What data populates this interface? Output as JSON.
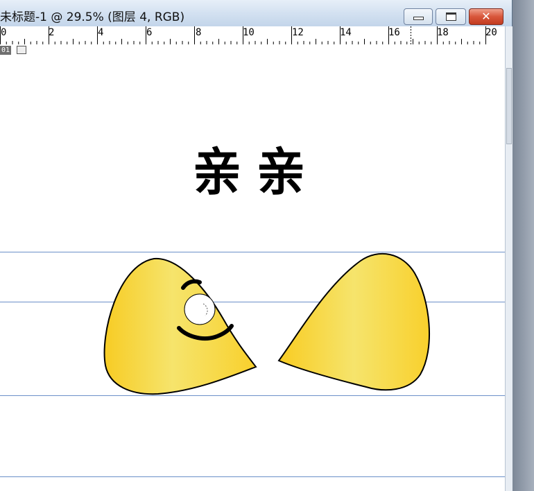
{
  "window": {
    "title": "未标题-1 @ 29.5% (图层 4, RGB)",
    "min_icon": "minimize-icon",
    "max_icon": "maximize-icon",
    "close_icon": "close-icon",
    "close_glyph": "✕"
  },
  "ruler": {
    "labels": [
      "0",
      "2",
      "4",
      "6",
      "8",
      "10",
      "12",
      "14",
      "16",
      "18",
      "20"
    ]
  },
  "corner": {
    "badge": "01",
    "icon": "mask-icon"
  },
  "canvas": {
    "headline": "亲亲",
    "guide_color": "#6a8fc8",
    "shape_fill_start": "#f8d23a",
    "shape_fill_mid": "#f5e36a",
    "eye_fill": "#ffffff"
  }
}
